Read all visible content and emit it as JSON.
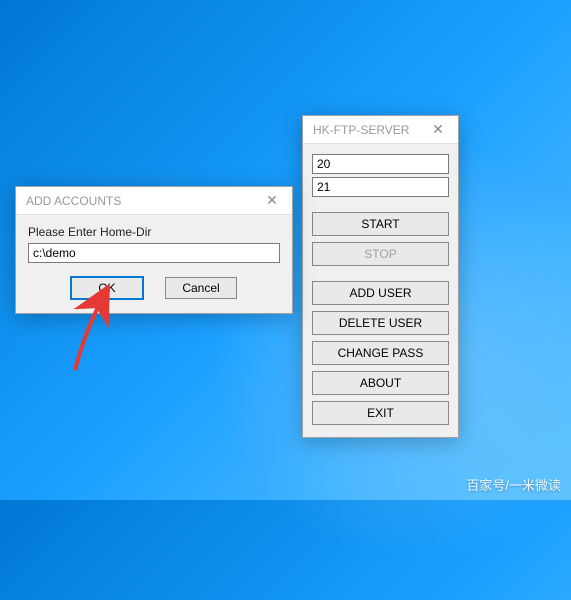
{
  "ftp": {
    "title": "HK-FTP-SERVER",
    "port1": "20",
    "port2": "21",
    "buttons": {
      "start": "START",
      "stop": "STOP",
      "add_user": "ADD USER",
      "delete_user": "DELETE USER",
      "change_pass": "CHANGE PASS",
      "about": "ABOUT",
      "exit": "EXIT"
    }
  },
  "dialog": {
    "title": "ADD ACCOUNTS",
    "label": "Please Enter Home-Dir",
    "value": "c:\\demo",
    "ok": "OK",
    "cancel": "Cancel"
  },
  "close_glyph": "✕",
  "watermark": "百家号/一米微读"
}
